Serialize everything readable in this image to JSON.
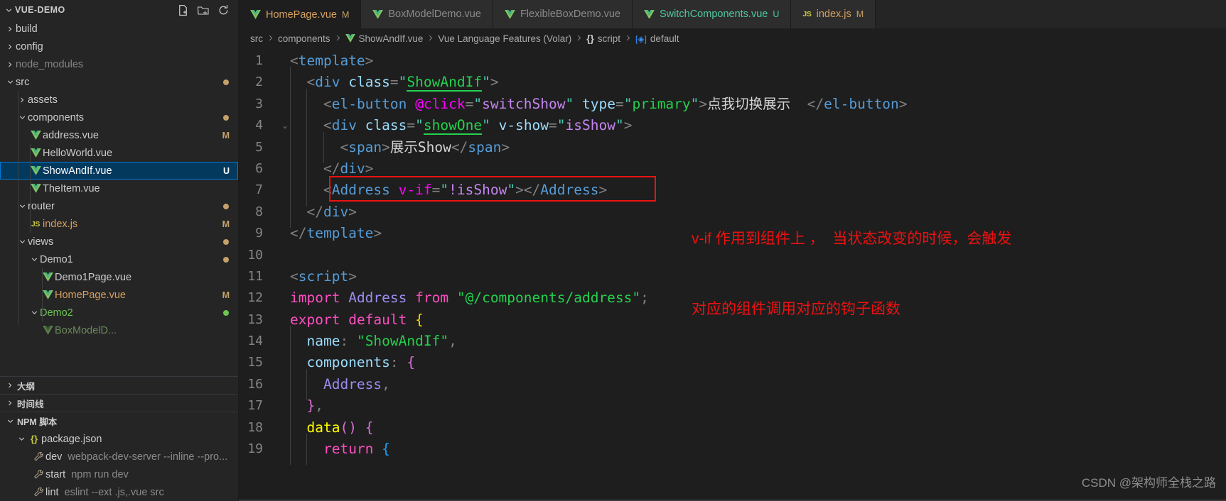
{
  "sidebar": {
    "header": {
      "title": "VUE-DEMO",
      "actions": [
        {
          "name": "new-file-icon",
          "label": "New File"
        },
        {
          "name": "new-folder-icon",
          "label": "New Folder"
        },
        {
          "name": "refresh-icon",
          "label": "Refresh Explorer"
        }
      ]
    },
    "tree": [
      {
        "label": "build",
        "type": "folder",
        "expanded": false,
        "indent": 0,
        "badge": "",
        "dot": false,
        "selected": false
      },
      {
        "label": "config",
        "type": "folder",
        "expanded": false,
        "indent": 0,
        "badge": "",
        "dot": false,
        "selected": false
      },
      {
        "label": "node_modules",
        "type": "folder-dim",
        "expanded": false,
        "indent": 0,
        "badge": "",
        "dot": false,
        "selected": false
      },
      {
        "label": "src",
        "type": "folder-mod",
        "expanded": true,
        "indent": 0,
        "badge": "",
        "dot": true,
        "selected": false
      },
      {
        "label": "assets",
        "type": "folder",
        "expanded": false,
        "indent": 1,
        "badge": "",
        "dot": false,
        "selected": false
      },
      {
        "label": "components",
        "type": "folder-mod",
        "expanded": true,
        "indent": 1,
        "badge": "",
        "dot": true,
        "selected": false
      },
      {
        "label": "address.vue",
        "type": "vue",
        "indent": 2,
        "badge": "M",
        "badgeColor": "#c5a06a",
        "dot": false,
        "selected": false
      },
      {
        "label": "HelloWorld.vue",
        "type": "vue",
        "indent": 2,
        "badge": "",
        "dot": false,
        "selected": false
      },
      {
        "label": "ShowAndIf.vue",
        "type": "vue",
        "indent": 2,
        "badge": "U",
        "badgeColor": "#ffffff",
        "dot": false,
        "selected": true
      },
      {
        "label": "TheItem.vue",
        "type": "vue",
        "indent": 2,
        "badge": "",
        "dot": false,
        "selected": false
      },
      {
        "label": "router",
        "type": "folder-mod",
        "expanded": true,
        "indent": 1,
        "badge": "",
        "dot": true,
        "selected": false
      },
      {
        "label": "index.js",
        "type": "js",
        "indent": 2,
        "badge": "M",
        "badgeColor": "#c5a06a",
        "dot": false,
        "selected": false
      },
      {
        "label": "views",
        "type": "folder-mod",
        "expanded": true,
        "indent": 1,
        "badge": "",
        "dot": true,
        "selected": false
      },
      {
        "label": "Demo1",
        "type": "folder-mod",
        "expanded": true,
        "indent": 2,
        "badge": "",
        "dot": true,
        "selected": false
      },
      {
        "label": "Demo1Page.vue",
        "type": "vue",
        "indent": 3,
        "badge": "",
        "dot": false,
        "selected": false
      },
      {
        "label": "HomePage.vue",
        "type": "vue-mod",
        "indent": 3,
        "badge": "M",
        "badgeColor": "#c5a06a",
        "dot": false,
        "selected": false
      },
      {
        "label": "Demo2",
        "type": "folder-new",
        "expanded": true,
        "indent": 2,
        "badge": "",
        "dot": true,
        "dotColor": "#6cc551",
        "selected": false
      },
      {
        "label": "BoxModelD...",
        "type": "vue-clip",
        "indent": 3,
        "badge": "",
        "dot": false,
        "selected": false
      }
    ],
    "panels": [
      {
        "label": "大纲",
        "expanded": false,
        "name": "outline-panel"
      },
      {
        "label": "时间线",
        "expanded": false,
        "name": "timeline-panel"
      }
    ],
    "npm": {
      "label": "NPM 脚本",
      "expanded": true,
      "package": "package.json",
      "scripts": [
        {
          "name": "dev",
          "cmd": "webpack-dev-server --inline --pro..."
        },
        {
          "name": "start",
          "cmd": "npm run dev"
        },
        {
          "name": "lint",
          "cmd": "eslint --ext .js,.vue src"
        }
      ]
    }
  },
  "tabs": [
    {
      "label": "HomePage.vue",
      "icon": "vue-icon",
      "badge": "M",
      "active": true,
      "color": "#d7a060",
      "badgeColor": "#c5a06a"
    },
    {
      "label": "BoxModelDemo.vue",
      "icon": "vue-icon",
      "badge": "",
      "active": false,
      "color": "#8a8a8a",
      "badgeColor": ""
    },
    {
      "label": "FlexibleBoxDemo.vue",
      "icon": "vue-icon",
      "badge": "",
      "active": false,
      "color": "#8a8a8a",
      "badgeColor": ""
    },
    {
      "label": "SwitchComponents.vue",
      "icon": "vue-icon",
      "badge": "U",
      "active": false,
      "color": "#4ec9a0",
      "badgeColor": "#4ec9a0"
    },
    {
      "label": "index.js",
      "icon": "js-icon",
      "badge": "M",
      "active": false,
      "color": "#d7a060",
      "badgeColor": "#c5a06a"
    }
  ],
  "breadcrumbs": [
    {
      "label": "src",
      "icon": ""
    },
    {
      "label": "components",
      "icon": ""
    },
    {
      "label": "ShowAndIf.vue",
      "icon": "vue-icon"
    },
    {
      "label": "Vue Language Features (Volar)",
      "icon": ""
    },
    {
      "label": "script",
      "icon": "braces-icon"
    },
    {
      "label": "default",
      "icon": "symbol-icon"
    }
  ],
  "code": {
    "language": "vue",
    "first_line": 1,
    "lines": [
      {
        "n": 1,
        "text": "<template>"
      },
      {
        "n": 2,
        "text": "  <div class=\"ShowAndIf\">"
      },
      {
        "n": 3,
        "text": "    <el-button @click=\"switchShow\" type=\"primary\">点我切换展示  </el-button>"
      },
      {
        "n": 4,
        "text": "    <div class=\"showOne\" v-show=\"isShow\">",
        "fold": true
      },
      {
        "n": 5,
        "text": "      <span>展示Show</span>"
      },
      {
        "n": 6,
        "text": "    </div>"
      },
      {
        "n": 7,
        "text": "    <Address v-if=\"!isShow\"></Address>",
        "highlighted": true
      },
      {
        "n": 8,
        "text": "  </div>"
      },
      {
        "n": 9,
        "text": "</template>"
      },
      {
        "n": 10,
        "text": ""
      },
      {
        "n": 11,
        "text": "<script>"
      },
      {
        "n": 12,
        "text": "import Address from \"@/components/address\";"
      },
      {
        "n": 13,
        "text": "export default {"
      },
      {
        "n": 14,
        "text": "  name: \"ShowAndIf\","
      },
      {
        "n": 15,
        "text": "  components: {"
      },
      {
        "n": 16,
        "text": "    Address,"
      },
      {
        "n": 17,
        "text": "  },"
      },
      {
        "n": 18,
        "text": "  data() {"
      },
      {
        "n": 19,
        "text": "    return {"
      }
    ]
  },
  "annotation": {
    "line1": "v-if 作用到组件上 ，  当状态改变的时候，会触发",
    "line2": "对应的组件调用对应的钩子函数",
    "color": "#ee1111"
  },
  "watermark": "CSDN @架构师全栈之路",
  "colors": {
    "selection": "#04395e",
    "selection_border": "#0078d4",
    "sidebar_bg": "#252526",
    "editor_bg": "#1e1e1e",
    "modified": "#c5a06a",
    "untracked": "#4ec9a0",
    "annotation_red": "#ee1111"
  }
}
